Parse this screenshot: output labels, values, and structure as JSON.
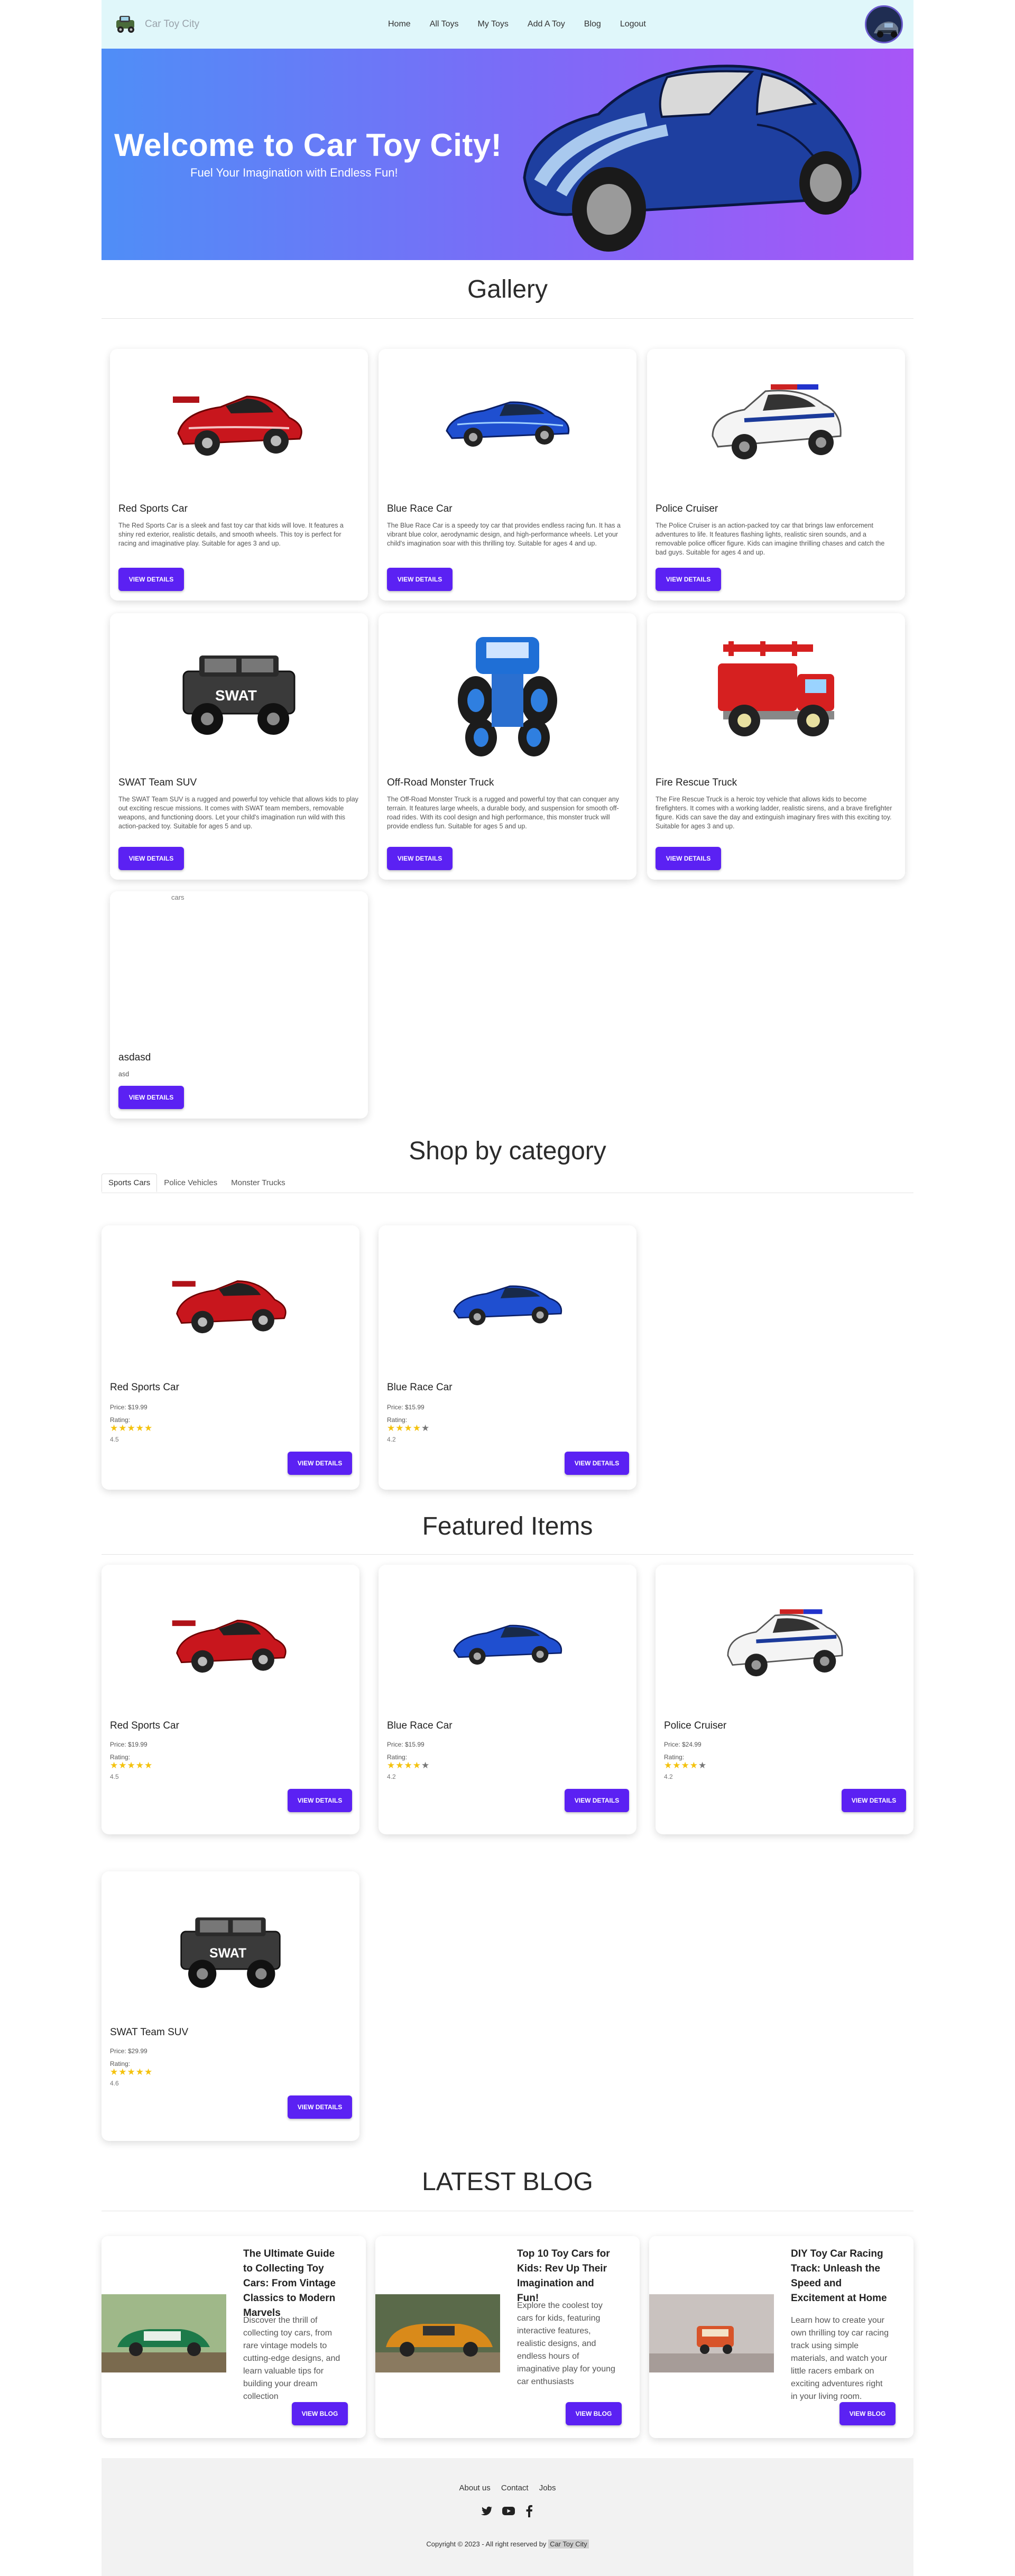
{
  "nav": {
    "brand": "Car Toy City",
    "links": [
      "Home",
      "All Toys",
      "My Toys",
      "Add A Toy",
      "Blog",
      "Logout"
    ]
  },
  "hero": {
    "title": "Welcome to Car Toy City!",
    "subtitle": "Fuel Your Imagination with Endless Fun!"
  },
  "gallery": {
    "title": "Gallery",
    "button_label": "View Details",
    "items": [
      {
        "name": "Red Sports Car",
        "desc": "The Red Sports Car is a sleek and fast toy car that kids will love. It features a shiny red exterior, realistic details, and smooth wheels. This toy is perfect for racing and imaginative play. Suitable for ages 3 and up."
      },
      {
        "name": "Blue Race Car",
        "desc": "The Blue Race Car is a speedy toy car that provides endless racing fun. It has a vibrant blue color, aerodynamic design, and high-performance wheels. Let your child's imagination soar with this thrilling toy. Suitable for ages 4 and up."
      },
      {
        "name": "Police Cruiser",
        "desc": "The Police Cruiser is an action-packed toy car that brings law enforcement adventures to life. It features flashing lights, realistic siren sounds, and a removable police officer figure. Kids can imagine thrilling chases and catch the bad guys. Suitable for ages 4 and up."
      },
      {
        "name": "SWAT Team SUV",
        "desc": "The SWAT Team SUV is a rugged and powerful toy vehicle that allows kids to play out exciting rescue missions. It comes with SWAT team members, removable weapons, and functioning doors. Let your child's imagination run wild with this action-packed toy. Suitable for ages 5 and up."
      },
      {
        "name": "Off-Road Monster Truck",
        "desc": "The Off-Road Monster Truck is a rugged and powerful toy that can conquer any terrain. It features large wheels, a durable body, and suspension for smooth off-road rides. With its cool design and high performance, this monster truck will provide endless fun. Suitable for ages 5 and up."
      },
      {
        "name": "Fire Rescue Truck",
        "desc": "The Fire Rescue Truck is a heroic toy vehicle that allows kids to become firefighters. It comes with a working ladder, realistic sirens, and a brave firefighter figure. Kids can save the day and extinguish imaginary fires with this exciting toy. Suitable for ages 3 and up."
      },
      {
        "name": "asdasd",
        "desc": "asd",
        "alt": "cars"
      }
    ]
  },
  "shop": {
    "title": "Shop by category",
    "tabs": [
      "Sports Cars",
      "Police Vehicles",
      "Monster Trucks"
    ],
    "items": [
      {
        "name": "Red Sports Car",
        "price": "Price: $19.99",
        "rating_label": "Rating:",
        "rating": "4.5",
        "rating_value": 4.5
      },
      {
        "name": "Blue Race Car",
        "price": "Price: $15.99",
        "rating_label": "Rating:",
        "rating": "4.2",
        "rating_value": 4.2
      }
    ]
  },
  "featured": {
    "title": "Featured Items",
    "items": [
      {
        "name": "Red Sports Car",
        "price": "Price: $19.99",
        "rating_label": "Rating:",
        "rating": "4.5",
        "rating_value": 4.5
      },
      {
        "name": "Blue Race Car",
        "price": "Price: $15.99",
        "rating_label": "Rating:",
        "rating": "4.2",
        "rating_value": 4.2
      },
      {
        "name": "Police Cruiser",
        "price": "Price: $24.99",
        "rating_label": "Rating:",
        "rating": "4.2",
        "rating_value": 4.2
      },
      {
        "name": "SWAT Team SUV",
        "price": "Price: $29.99",
        "rating_label": "Rating:",
        "rating": "4.6",
        "rating_value": 4.6
      }
    ]
  },
  "blog": {
    "title": "LATEST BLOG",
    "button_label": "View Blog",
    "posts": [
      {
        "title": "The Ultimate Guide to Collecting Toy Cars: From Vintage Classics to Modern Marvels",
        "desc": "Discover the thrill of collecting toy cars, from rare vintage models to cutting-edge designs, and learn valuable tips for building your dream collection"
      },
      {
        "title": "Top 10 Toy Cars for Kids: Rev Up Their Imagination and Fun!",
        "desc": "Explore the coolest toy cars for kids, featuring interactive features, realistic designs, and endless hours of imaginative play for young car enthusiasts"
      },
      {
        "title": "DIY Toy Car Racing Track: Unleash the Speed and Excitement at Home",
        "desc": "Learn how to create your own thrilling toy car racing track using simple materials, and watch your little racers embark on exciting adventures right in your living room."
      }
    ]
  },
  "footer": {
    "links": [
      "About us",
      "Contact",
      "Jobs"
    ],
    "copyright": "Copyright © 2023 - All right reserved by",
    "brand": "Car Toy City",
    "social": [
      "twitter-icon",
      "youtube-icon",
      "facebook-icon"
    ]
  },
  "colors": {
    "accent": "#5b21f3",
    "nav_bg": "#e0f7fa",
    "star": "#f4c20d"
  }
}
